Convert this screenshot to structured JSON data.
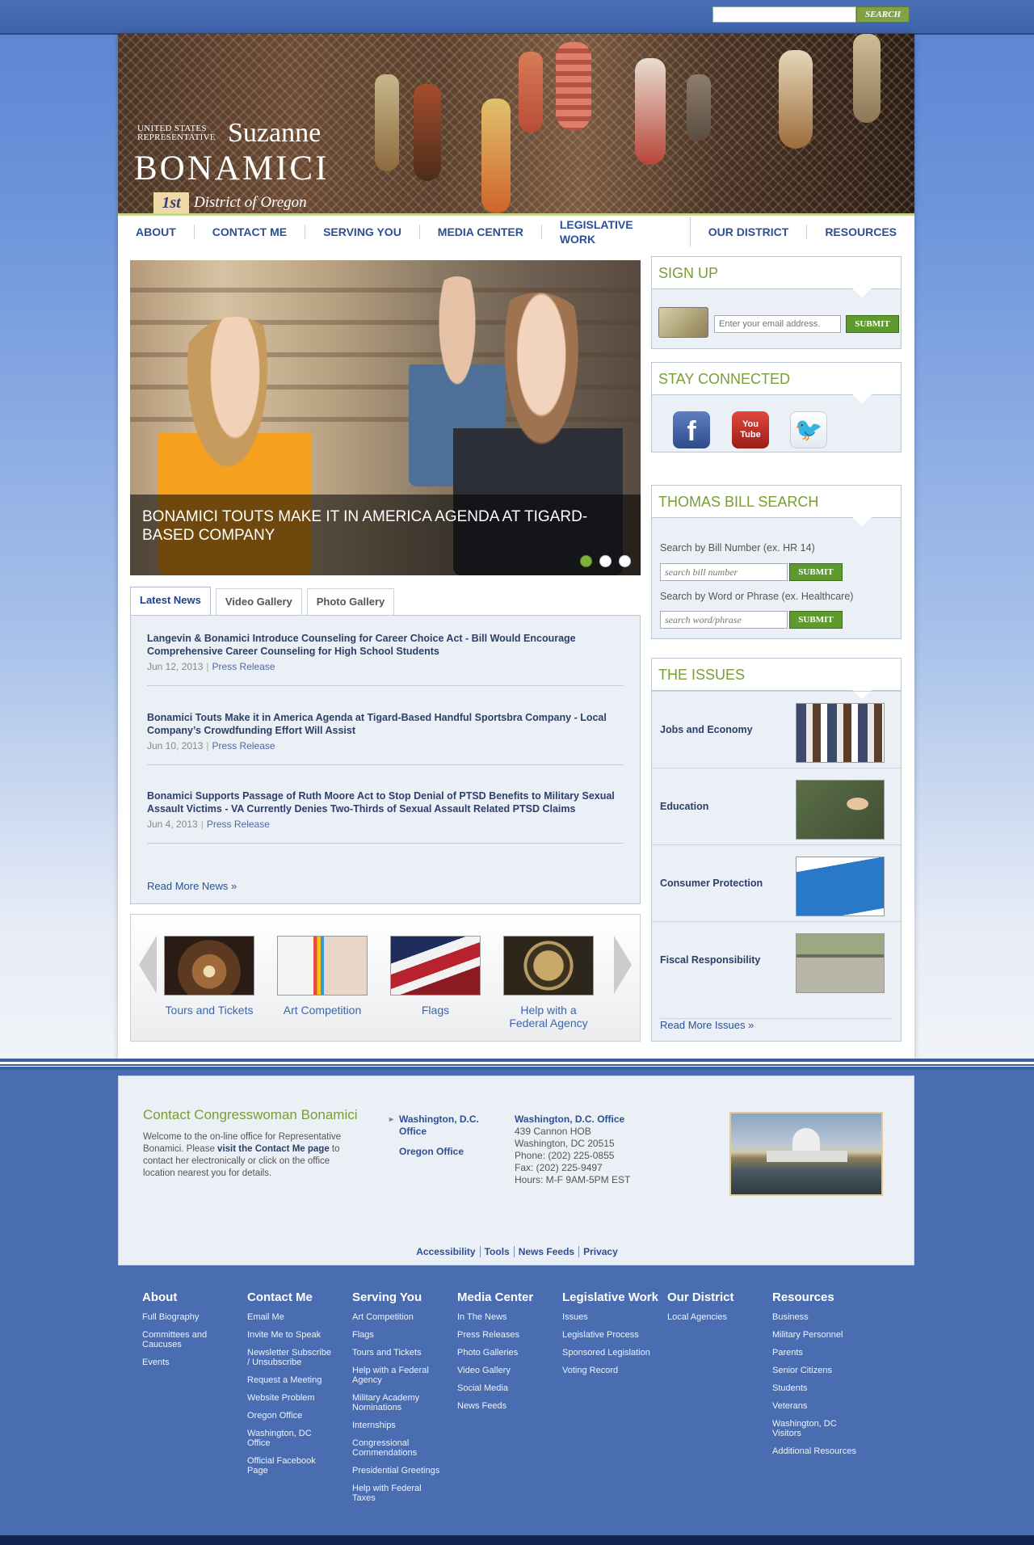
{
  "top": {
    "search_placeholder": "",
    "search_button": "SEARCH"
  },
  "brand": {
    "us_line": "UNITED STATES REPRESENTATIVE",
    "first": "Suzanne",
    "last": "BONAMICI",
    "district_num": "1st",
    "district_text": "District of Oregon"
  },
  "nav": [
    "ABOUT",
    "CONTACT ME",
    "SERVING YOU",
    "MEDIA CENTER",
    "LEGISLATIVE WORK",
    "OUR DISTRICT",
    "RESOURCES"
  ],
  "hero": {
    "title": "BONAMICI TOUTS MAKE IT IN AMERICA AGENDA AT TIGARD-BASED COMPANY",
    "slides": 3,
    "active_slide": 1
  },
  "tabs": [
    "Latest News",
    "Video Gallery",
    "Photo Gallery"
  ],
  "news": [
    {
      "title": "Langevin & Bonamici Introduce Counseling for Career Choice Act - Bill Would Encourage Comprehensive Career Counseling for High School Students",
      "date": "Jun 12, 2013",
      "type": "Press Release"
    },
    {
      "title": "Bonamici Touts Make it in America Agenda at Tigard-Based Handful Sportsbra Company - Local Company’s Crowdfunding Effort Will Assist",
      "date": "Jun 10, 2013",
      "type": "Press Release"
    },
    {
      "title": "Bonamici Supports Passage of Ruth Moore Act to Stop Denial of PTSD Benefits to Military Sexual Assault Victims - VA Currently Denies Two-Thirds of Sexual Assault Related PTSD Claims",
      "date": "Jun 4, 2013",
      "type": "Press Release"
    }
  ],
  "news_more": "Read More News »",
  "quicklinks": [
    "Tours and Tickets",
    "Art Competition",
    "Flags",
    "Help with a Federal Agency"
  ],
  "signup": {
    "title": "SIGN UP",
    "placeholder": "Enter your email address.",
    "button": "SUBMIT"
  },
  "connected": {
    "title": "STAY CONNECTED",
    "icons": [
      "facebook-icon",
      "youtube-icon",
      "twitter-icon"
    ],
    "youtube_text": "You Tube"
  },
  "thomas": {
    "title": "THOMAS BILL SEARCH",
    "label1": "Search by Bill Number (ex. HR 14)",
    "ph1": "search bill number",
    "label2": "Search by Word or Phrase (ex. Healthcare)",
    "ph2": "search word/phrase",
    "button": "SUBMIT"
  },
  "issues": {
    "title": "THE ISSUES",
    "items": [
      "Jobs and Economy",
      "Education",
      "Consumer Protection",
      "Fiscal Responsibility"
    ],
    "more": "Read More Issues »"
  },
  "contact": {
    "heading": "Contact Congresswoman Bonamici",
    "welcome_a": "Welcome to the on-line office for Representative Bonamici. Please ",
    "welcome_link": "visit the Contact Me page",
    "welcome_b": " to contact her electronically or click on the office location nearest you for details.",
    "offices": [
      "Washington, D.C. Office",
      "Oregon Office"
    ],
    "detail": {
      "title": "Washington, D.C. Office",
      "lines": [
        "439 Cannon HOB",
        "Washington, DC 20515",
        "Phone: (202) 225-0855",
        "Fax: (202) 225-9497",
        "Hours: M-F 9AM-5PM EST"
      ]
    }
  },
  "util": [
    "Accessibility",
    "Tools",
    "News Feeds",
    "Privacy"
  ],
  "sitemap": [
    {
      "h": "About",
      "links": [
        "Full Biography",
        "Committees and Caucuses",
        "Events"
      ]
    },
    {
      "h": "Contact Me",
      "links": [
        "Email Me",
        "Invite Me to Speak",
        "Newsletter Subscribe / Unsubscribe",
        "Request a Meeting",
        "Website Problem",
        "Oregon Office",
        "Washington, DC Office",
        "Official Facebook Page"
      ]
    },
    {
      "h": "Serving You",
      "links": [
        "Art Competition",
        "Flags",
        "Tours and Tickets",
        "Help with a Federal Agency",
        "Military Academy Nominations",
        "Internships",
        "Congressional Commendations",
        "Presidential Greetings",
        "Help with Federal Taxes"
      ]
    },
    {
      "h": "Media Center",
      "links": [
        "In The News",
        "Press Releases",
        "Photo Galleries",
        "Video Gallery",
        "Social Media",
        "News Feeds"
      ]
    },
    {
      "h": "Legislative Work",
      "links": [
        "Issues",
        "Legislative Process",
        "Sponsored Legislation",
        "Voting Record"
      ]
    },
    {
      "h": "Our District",
      "links": [
        "Local Agencies"
      ]
    },
    {
      "h": "Resources",
      "links": [
        "Business",
        "Military Personnel",
        "Parents",
        "Senior Citizens",
        "Students",
        "Veterans",
        "Washington, DC Visitors",
        "Additional Resources"
      ]
    }
  ],
  "colors": {
    "green": "#7a9d36",
    "nav_blue": "#2c4f95",
    "footer_blue": "#4a6db1"
  }
}
